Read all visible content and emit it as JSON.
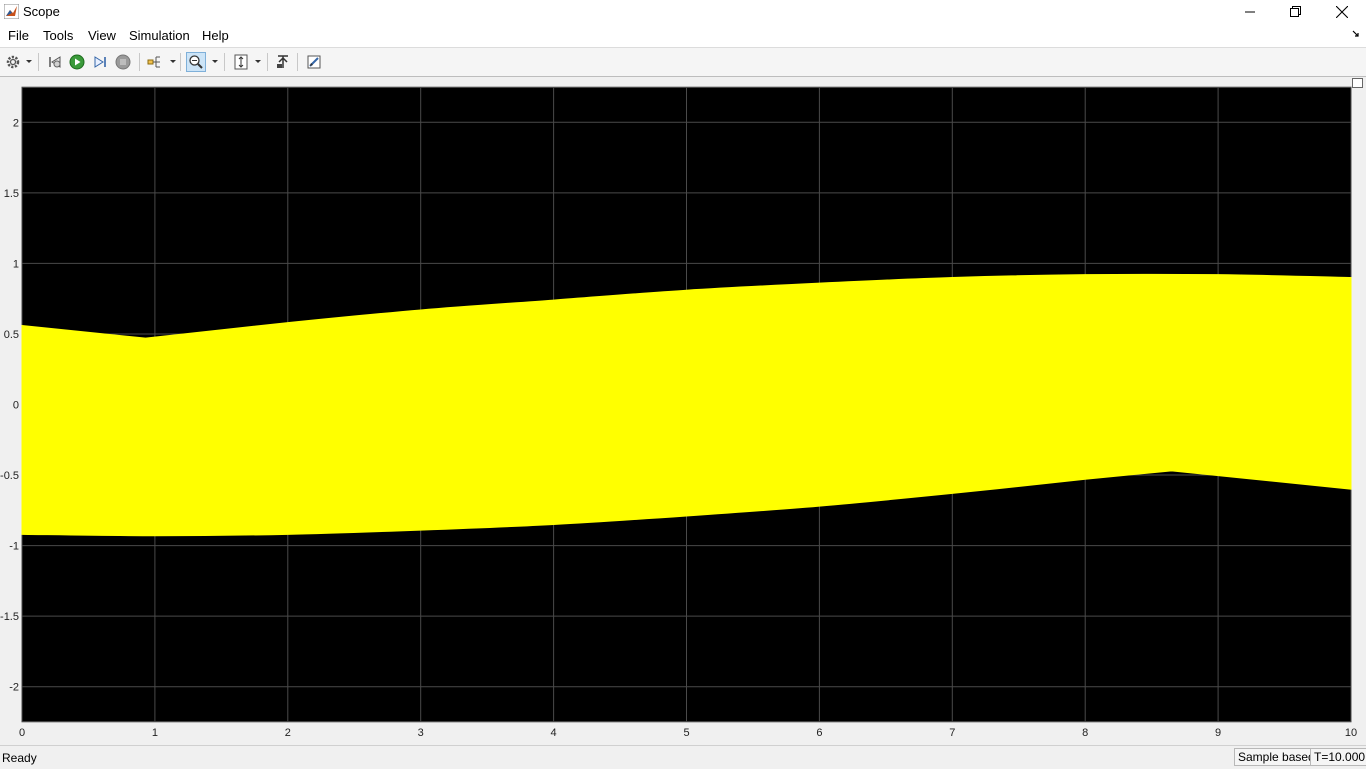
{
  "window": {
    "title": "Scope"
  },
  "menu": {
    "items": [
      "File",
      "Tools",
      "View",
      "Simulation",
      "Help"
    ]
  },
  "toolbar": {
    "buttons": [
      "settings-icon",
      "step-back-icon",
      "run-icon",
      "step-forward-icon",
      "stop-icon",
      "signal-selector-icon",
      "zoom-in-icon",
      "scale-axes-icon",
      "highlight-block-icon",
      "print-icon"
    ]
  },
  "status": {
    "text": "Ready",
    "mode": "Sample based",
    "time": "T=10.000"
  },
  "colors": {
    "plot_bg": "#000000",
    "grid": "#4a4a4a",
    "signal": "#ffff00"
  },
  "chart_data": {
    "type": "area",
    "title": "",
    "xlabel": "",
    "ylabel": "",
    "xlim": [
      0,
      10
    ],
    "ylim": [
      -2.25,
      2.25
    ],
    "xticks": [
      0,
      1,
      2,
      3,
      4,
      5,
      6,
      7,
      8,
      9,
      10
    ],
    "yticks": [
      2,
      1.5,
      1,
      0.5,
      0,
      -0.5,
      -1,
      -1.5,
      -2
    ],
    "xtick_labels": [
      "0",
      "1",
      "2",
      "3",
      "4",
      "5",
      "6",
      "7",
      "8",
      "9",
      "10"
    ],
    "ytick_labels": [
      "2",
      "1.5",
      "1",
      "0.5",
      "0",
      "-0.5",
      "-1",
      "-1.5",
      "-2"
    ],
    "grid": true,
    "series": [
      {
        "upper_envelope": {
          "x": [
            0,
            0.93,
            2,
            3,
            4,
            5,
            6,
            7,
            8,
            9,
            10
          ],
          "y": [
            0.56,
            0.47,
            0.58,
            0.67,
            0.74,
            0.81,
            0.86,
            0.9,
            0.92,
            0.92,
            0.9
          ]
        },
        "lower_envelope": {
          "x": [
            0,
            1,
            2,
            3,
            4,
            5,
            6,
            7,
            8,
            8.65,
            10
          ],
          "y": [
            -0.92,
            -0.93,
            -0.92,
            -0.89,
            -0.85,
            -0.79,
            -0.72,
            -0.63,
            -0.53,
            -0.47,
            -0.6
          ]
        }
      }
    ]
  }
}
